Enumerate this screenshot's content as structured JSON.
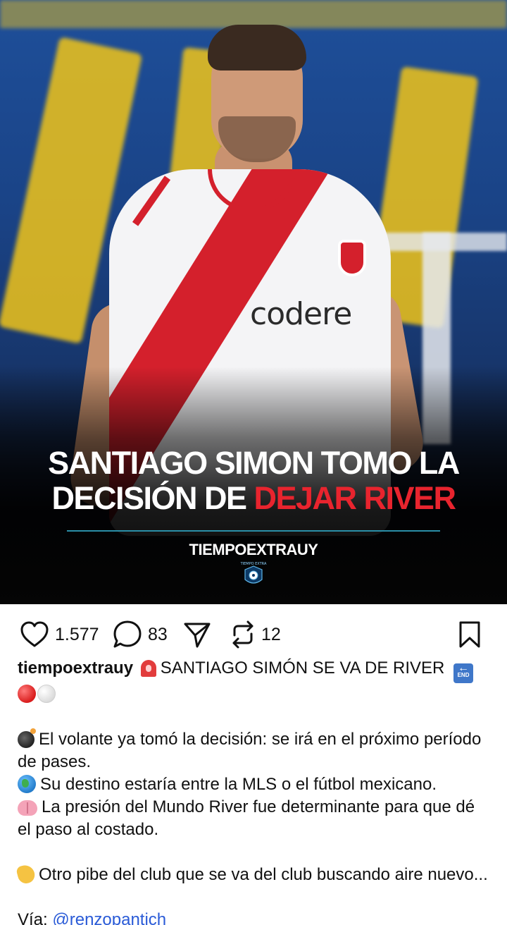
{
  "post": {
    "headline_line1": "SANTIAGO SIMON TOMO LA",
    "headline_line2_white": "DECISIÓN DE ",
    "headline_line2_red": "DEJAR RIVER",
    "brand": "TIEMPOEXTRAUY",
    "sponsor": "codere",
    "brand_logo_text": "TIEMPO EXTRA"
  },
  "actions": {
    "likes": "1.577",
    "comments": "83",
    "reposts": "12",
    "icons": [
      "heart-icon",
      "comment-icon",
      "share-icon",
      "repost-icon",
      "bookmark-icon"
    ]
  },
  "caption": {
    "username": "tiempoextrauy",
    "title": "SANTIAGO SIMÓN SE VA DE RIVER",
    "line1a": "El volante ya tomó la decisión: se irá en el próximo período",
    "line1b": "de pases.",
    "line2": "Su destino estaría entre la MLS o el fútbol mexicano.",
    "line3a": "La presión del Mundo River fue determinante para que dé",
    "line3b": "el paso al costado.",
    "line4": "Otro pibe del club que se va del club buscando aire nuevo...",
    "via_label": "Vía: ",
    "via_handle": "@renzopantich",
    "end_emoji_text": "END"
  },
  "colors": {
    "accent_red": "#e8242e",
    "link_blue": "#2a5bd7",
    "divider_teal": "#2a8fa8"
  }
}
